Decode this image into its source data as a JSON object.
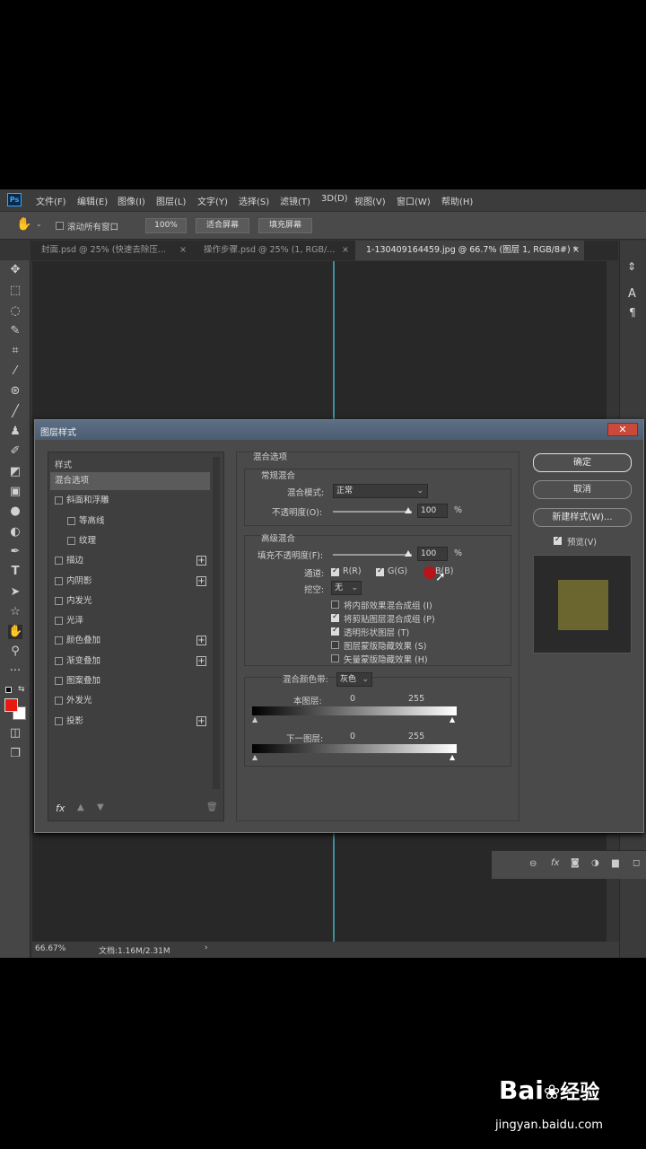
{
  "menubar": {
    "logo": "Ps",
    "items": [
      "文件(F)",
      "编辑(E)",
      "图像(I)",
      "图层(L)",
      "文字(Y)",
      "选择(S)",
      "滤镜(T)",
      "3D(D)",
      "视图(V)",
      "窗口(W)",
      "帮助(H)"
    ]
  },
  "optionsbar": {
    "scroll_all": "滚动所有窗口",
    "zoom_100": "100%",
    "fit_screen": "适合屏幕",
    "fill_screen": "填充屏幕"
  },
  "tabs": [
    {
      "label": "封面.psd @ 25% (快速去除压...",
      "close": "×"
    },
    {
      "label": "操作步骤.psd @ 25% (1, RGB/...",
      "close": "×"
    },
    {
      "label": "1-130409164459.jpg @ 66.7% (图层 1, RGB/8#) *",
      "close": "×"
    }
  ],
  "status": {
    "zoom": "66.67%",
    "doc": "文档:1.16M/2.31M",
    "arrow": "›"
  },
  "dialog": {
    "title": "图层样式",
    "close": "✕",
    "styles_header": "样式",
    "style_items": [
      {
        "label": "混合选项",
        "checkbox": false,
        "plus": false,
        "selected": true,
        "indent": false
      },
      {
        "label": "斜面和浮雕",
        "checkbox": true,
        "plus": false,
        "selected": false,
        "indent": false
      },
      {
        "label": "等高线",
        "checkbox": true,
        "plus": false,
        "selected": false,
        "indent": true
      },
      {
        "label": "纹理",
        "checkbox": true,
        "plus": false,
        "selected": false,
        "indent": true
      },
      {
        "label": "描边",
        "checkbox": true,
        "plus": true,
        "selected": false,
        "indent": false
      },
      {
        "label": "内阴影",
        "checkbox": true,
        "plus": true,
        "selected": false,
        "indent": false
      },
      {
        "label": "内发光",
        "checkbox": true,
        "plus": false,
        "selected": false,
        "indent": false
      },
      {
        "label": "光泽",
        "checkbox": true,
        "plus": false,
        "selected": false,
        "indent": false
      },
      {
        "label": "颜色叠加",
        "checkbox": true,
        "plus": true,
        "selected": false,
        "indent": false
      },
      {
        "label": "渐变叠加",
        "checkbox": true,
        "plus": true,
        "selected": false,
        "indent": false
      },
      {
        "label": "图案叠加",
        "checkbox": true,
        "plus": false,
        "selected": false,
        "indent": false
      },
      {
        "label": "外发光",
        "checkbox": true,
        "plus": false,
        "selected": false,
        "indent": false
      },
      {
        "label": "投影",
        "checkbox": true,
        "plus": true,
        "selected": false,
        "indent": false
      }
    ],
    "fx": "fx",
    "blend_options_title": "混合选项",
    "general": {
      "title": "常规混合",
      "mode_label": "混合模式:",
      "mode_value": "正常",
      "opacity_label": "不透明度(O):",
      "opacity_value": "100",
      "opacity_fraction": 1.0,
      "unit": "%"
    },
    "advanced": {
      "title": "高级混合",
      "fill_label": "填充不透明度(F):",
      "fill_value": "100",
      "fill_fraction": 1.0,
      "unit": "%",
      "channels_label": "通道:",
      "channel_r": "R(R)",
      "channel_g": "G(G)",
      "channel_b": "B(B)",
      "knockout_label": "挖空:",
      "knockout_value": "无",
      "options": [
        {
          "label": "将内部效果混合成组 (I)",
          "checked": false
        },
        {
          "label": "将剪贴图层混合成组 (P)",
          "checked": true
        },
        {
          "label": "透明形状图层 (T)",
          "checked": true
        },
        {
          "label": "图层蒙版隐藏效果 (S)",
          "checked": false
        },
        {
          "label": "矢量蒙版隐藏效果 (H)",
          "checked": false
        }
      ]
    },
    "blend_if": {
      "label": "混合颜色带:",
      "value": "灰色",
      "this_layer": "本图层:",
      "underlying": "下一图层:",
      "min": "0",
      "max": "255"
    },
    "buttons": {
      "ok": "确定",
      "cancel": "取消",
      "new_style": "新建样式(W)...",
      "preview": "预览(V)"
    },
    "preview_color": "#6b6530"
  },
  "watermark": {
    "brand": "Bai",
    "brand2": "经验",
    "url": "jingyan.baidu.com"
  }
}
